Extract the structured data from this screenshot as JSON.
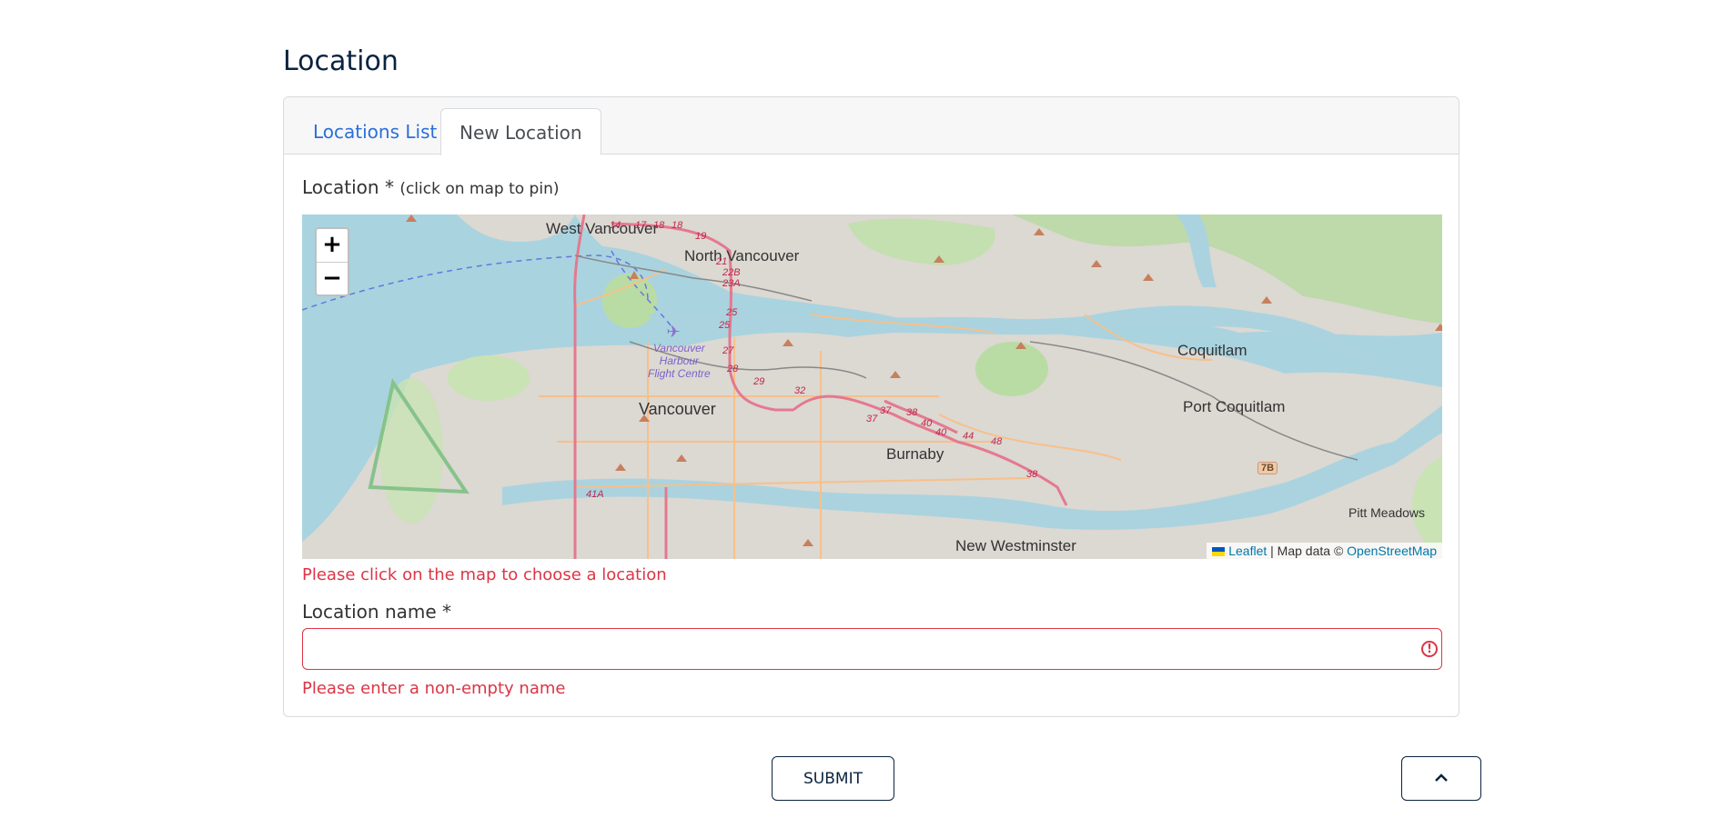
{
  "page": {
    "title": "Location"
  },
  "tabs": [
    {
      "label": "Locations List",
      "active": false
    },
    {
      "label": "New Location",
      "active": true
    }
  ],
  "form": {
    "location_label": "Location *",
    "location_hint": "(click on map to pin)",
    "location_error": "Please click on the map to choose a location",
    "name_label": "Location name *",
    "name_value": "",
    "name_placeholder": "",
    "name_error": "Please enter a non-empty name"
  },
  "map": {
    "zoom_in": "+",
    "zoom_out": "−",
    "attribution": {
      "leaflet": "Leaflet",
      "middle": " | Map data © ",
      "osm": "OpenStreetMap"
    },
    "place_labels": [
      "West Vancouver",
      "North Vancouver",
      "Vancouver",
      "Burnaby",
      "Coquitlam",
      "Port Coquitlam",
      "New Westminster",
      "Pitt Meadows"
    ],
    "airport_labels": [
      "Vancouver",
      "Harbour",
      "Flight Centre"
    ],
    "route_numbers": [
      "14",
      "17",
      "18",
      "18",
      "19",
      "21",
      "22B",
      "23A",
      "25",
      "25",
      "27",
      "28",
      "29",
      "32",
      "37",
      "37",
      "38",
      "40",
      "40",
      "44",
      "48",
      "38",
      "7B",
      "41A"
    ],
    "colors": {
      "water": "#aad3df",
      "land": "#d9d6d0",
      "park": "#b9dca4",
      "forest": "#add19e",
      "highway": "#e892a2",
      "arterial": "#f9b26b"
    }
  },
  "buttons": {
    "submit": "SUBMIT",
    "top_icon": "chevron-up-icon"
  },
  "theme": {
    "accent": "#0b2340",
    "link": "#2a6fdb",
    "error": "#dc3545"
  }
}
